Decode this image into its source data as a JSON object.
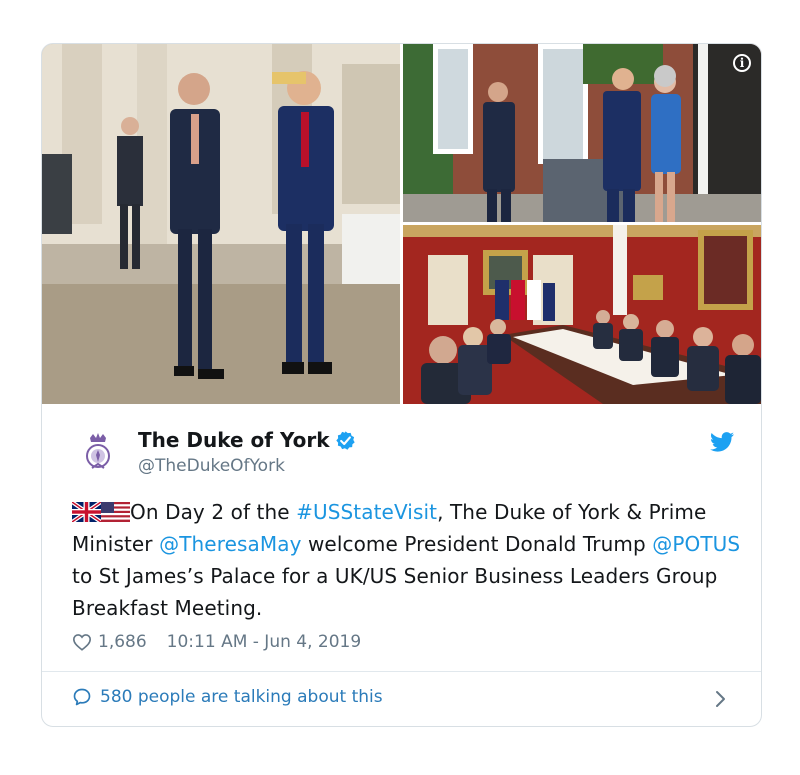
{
  "tweet": {
    "author_name": "The Duke of York",
    "author_handle": "@TheDukeOfYork",
    "text": {
      "flags": "🇬🇧🇺🇸",
      "part1": "On Day 2 of the ",
      "hashtag": "#USStateVisit",
      "part2": ", The Duke of York & Prime Minister ",
      "mention1": "@TheresaMay",
      "part3": " welcome President Donald Trump ",
      "mention2": "@POTUS",
      "part4": " to St James’s Palace for a UK/US Senior Business Leaders Group Breakfast Meeting."
    },
    "likes": "1,686",
    "timestamp": "10:11 AM - Jun 4, 2019",
    "talking": "580 people are talking about this"
  },
  "icons": {
    "info": "info-icon",
    "verified": "verified-badge-icon",
    "bird": "twitter-bird-icon",
    "heart": "heart-icon",
    "bubble": "speech-bubble-icon",
    "chevron": "chevron-right-icon"
  },
  "colors": {
    "link": "#1b95e0",
    "muted": "#657786",
    "talk_link": "#2b7bb9",
    "border": "#d8dfe4"
  }
}
